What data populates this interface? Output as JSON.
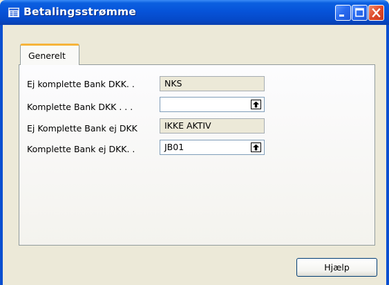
{
  "window": {
    "title": "Betalingsstrømme",
    "controls": {
      "minimize": "minimize-icon",
      "maximize": "maximize-icon",
      "close": "close-icon"
    }
  },
  "tabs": [
    {
      "label": "Generelt",
      "active": true
    }
  ],
  "fields": [
    {
      "label": "Ej komplette Bank DKK. .",
      "value": "NKS",
      "editable": false,
      "lookup": false
    },
    {
      "label": "Komplette Bank DKK . . .",
      "value": "",
      "editable": true,
      "lookup": true
    },
    {
      "label": "Ej Komplette Bank ej DKK",
      "value": "IKKE AKTIV",
      "editable": false,
      "lookup": false
    },
    {
      "label": "Komplette Bank ej DKK. .",
      "value": "JB01",
      "editable": true,
      "lookup": true
    }
  ],
  "buttons": {
    "help": "Hjælp"
  },
  "colors": {
    "titlebar": "#0653d9",
    "tab_highlight": "#f6b43a",
    "close_button": "#df4a2a",
    "window_bg": "#ece9d8"
  }
}
